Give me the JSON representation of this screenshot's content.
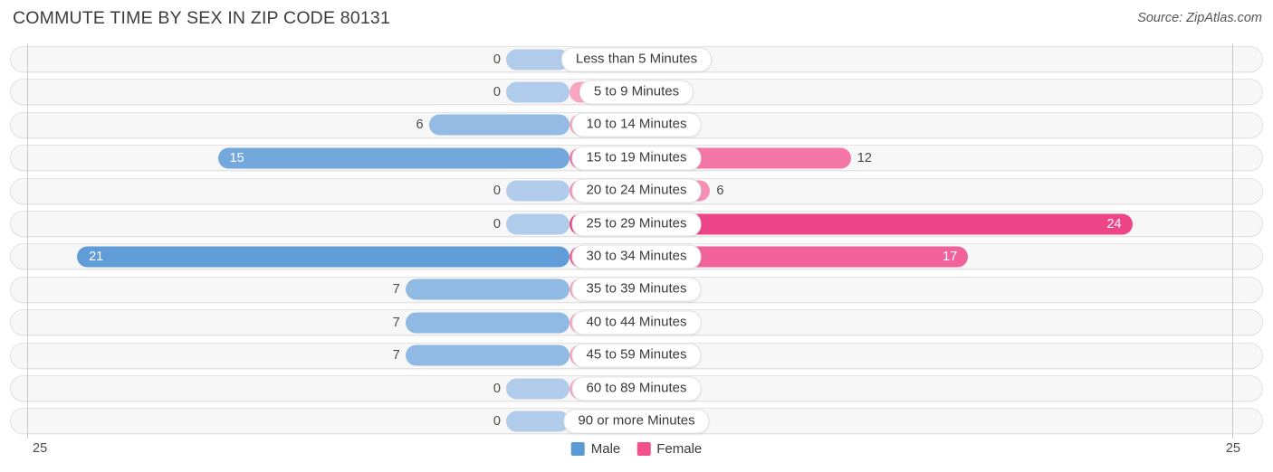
{
  "header": {
    "title": "COMMUTE TIME BY SEX IN ZIP CODE 80131",
    "source": "Source: ZipAtlas.com"
  },
  "legend": {
    "male_label": "Male",
    "female_label": "Female",
    "male_color": "#5b9bd5",
    "female_color": "#f2508b"
  },
  "axis": {
    "left_end": "25",
    "right_end": "25",
    "max": 25
  },
  "chart_data": {
    "type": "bar",
    "orientation": "horizontal-diverging",
    "title": "COMMUTE TIME BY SEX IN ZIP CODE 80131",
    "xlabel": "",
    "ylabel": "",
    "xlim": [
      25,
      25
    ],
    "grid": false,
    "legend_position": "bottom-center",
    "categories": [
      "Less than 5 Minutes",
      "5 to 9 Minutes",
      "10 to 14 Minutes",
      "15 to 19 Minutes",
      "20 to 24 Minutes",
      "25 to 29 Minutes",
      "30 to 34 Minutes",
      "35 to 39 Minutes",
      "40 to 44 Minutes",
      "45 to 59 Minutes",
      "60 to 89 Minutes",
      "90 or more Minutes"
    ],
    "series": [
      {
        "name": "Male",
        "values": [
          0,
          0,
          6,
          15,
          0,
          0,
          21,
          7,
          7,
          7,
          0,
          0
        ]
      },
      {
        "name": "Female",
        "values": [
          0,
          0,
          0,
          12,
          6,
          24,
          17,
          0,
          0,
          0,
          0,
          0
        ]
      }
    ]
  },
  "rows": [
    {
      "category": "Less than 5 Minutes",
      "male": "0",
      "female": "0"
    },
    {
      "category": "5 to 9 Minutes",
      "male": "0",
      "female": "0"
    },
    {
      "category": "10 to 14 Minutes",
      "male": "6",
      "female": "0"
    },
    {
      "category": "15 to 19 Minutes",
      "male": "15",
      "female": "12"
    },
    {
      "category": "20 to 24 Minutes",
      "male": "0",
      "female": "6"
    },
    {
      "category": "25 to 29 Minutes",
      "male": "0",
      "female": "24"
    },
    {
      "category": "30 to 34 Minutes",
      "male": "21",
      "female": "17"
    },
    {
      "category": "35 to 39 Minutes",
      "male": "7",
      "female": "0"
    },
    {
      "category": "40 to 44 Minutes",
      "male": "7",
      "female": "0"
    },
    {
      "category": "45 to 59 Minutes",
      "male": "7",
      "female": "0"
    },
    {
      "category": "60 to 89 Minutes",
      "male": "0",
      "female": "0"
    },
    {
      "category": "90 or more Minutes",
      "male": "0",
      "female": "0"
    }
  ]
}
